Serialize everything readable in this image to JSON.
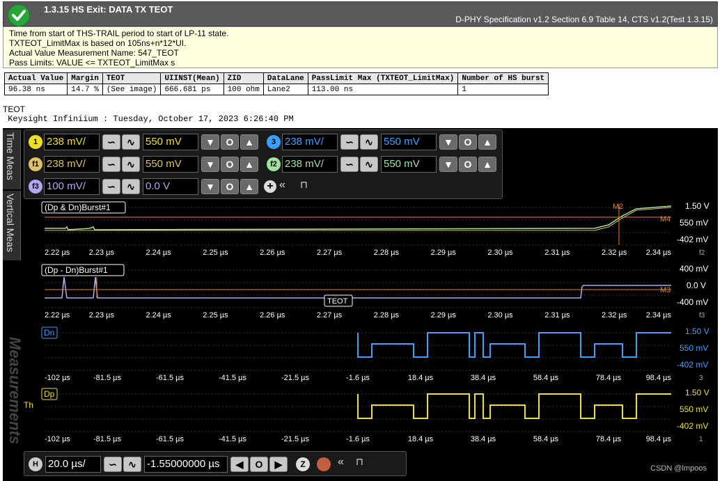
{
  "header": {
    "title": "1.3.15 HS Exit: DATA TX TEOT",
    "spec": "D-PHY Specification v1.2 Section 6.9 Table 14, CTS v1.2(Test 1.3.15)",
    "status_icon": "check-icon"
  },
  "description": {
    "line1": "Time from start of THS-TRAIL period to start of LP-11 state.",
    "line2": "TXTEOT_LimitMax is based on 105ns+n*12*UI.",
    "line3": "Actual Value Measurement Name: 547_TEOT",
    "line4": "Pass Limits: VALUE <= TXTEOT_LimitMax s"
  },
  "results": {
    "headers": [
      "Actual Value",
      "Margin",
      "TEOT",
      "UIINST(Mean)",
      "ZID",
      "DataLane",
      "PassLimit Max (TXTEOT_LimitMax)",
      "Number of HS burst"
    ],
    "values": [
      "96.38 ns",
      "14.7 %",
      "(See image)",
      "666.681 ps",
      "100 ohm",
      "Lane2",
      "113.00 ns",
      "1"
    ]
  },
  "caption": "TEOT",
  "scope_info": " Keysight Infiniium : Tuesday, October 17, 2023 6:26:40 PM",
  "tabs": {
    "time_meas": "Time Meas",
    "vertical_meas": "Vertical Meas",
    "measurements": "Measurements"
  },
  "channels": {
    "ch1": {
      "id": "1",
      "scale": "238 mV/",
      "offset": "550 mV",
      "color": "#f0e020"
    },
    "ch3": {
      "id": "3",
      "scale": "238 mV/",
      "offset": "550 mV",
      "color": "#3aa0ff"
    },
    "f1": {
      "id": "f1",
      "scale": "238 mV/",
      "offset": "550 mV",
      "color": "#e0c060"
    },
    "f2": {
      "id": "f2",
      "scale": "238 mV/",
      "offset": "550 mV",
      "color": "#a0e0a0"
    },
    "f3": {
      "id": "f3",
      "scale": "100 mV/",
      "offset": "0.0 V",
      "color": "#b0a8f0"
    }
  },
  "plots": [
    {
      "label": "(Dp & Dn)Burst#1",
      "ticks": [
        "2.22 µs",
        "2.23 µs",
        "2.24 µs",
        "2.25 µs",
        "2.26 µs",
        "2.27 µs",
        "2.28 µs",
        "2.29 µs",
        "2.30 µs",
        "2.31 µs",
        "2.32 µs",
        "2.34 µs"
      ],
      "right": [
        "1.50 V",
        "550 mV",
        "-402 mV"
      ],
      "markers": [
        "M2",
        "M4"
      ],
      "badge": "f2",
      "ch": "f1"
    },
    {
      "label": "(Dp - Dn)Burst#1",
      "ticks": [
        "2.22 µs",
        "2.23 µs",
        "2.24 µs",
        "2.25 µs",
        "2.26 µs",
        "2.27 µs",
        "2.28 µs",
        "2.29 µs",
        "2.30 µs",
        "2.31 µs",
        "2.32 µs",
        "2.34 µs"
      ],
      "right": [
        "400 mV",
        "0.0 V",
        "-400 mV"
      ],
      "markers": [
        "M3"
      ],
      "badge": "f3",
      "ch": "f3",
      "tag": "TEOT"
    },
    {
      "label": "Dn",
      "ticks": [
        "-102 µs",
        "-81.5 µs",
        "-61.5 µs",
        "-41.5 µs",
        "-21.5 µs",
        "-1.6 µs",
        "18.4 µs",
        "38.4 µs",
        "58.4 µs",
        "78.4 µs",
        "98.4 µs"
      ],
      "right": [
        "1.50 V",
        "550 mV",
        "-402 mV"
      ],
      "badge": "3",
      "ch": "3"
    },
    {
      "label": "Dp",
      "ticks": [
        "-102 µs",
        "-81.5 µs",
        "-61.5 µs",
        "-41.5 µs",
        "-21.5 µs",
        "-1.6 µs",
        "18.4 µs",
        "38.4 µs",
        "58.4 µs",
        "78.4 µs",
        "98.4 µs"
      ],
      "right": [
        "1.50 V",
        "550 mV",
        "-402 mV"
      ],
      "badge": "1",
      "ch": "Th",
      "th": "Th"
    }
  ],
  "timebase": {
    "h_label": "H",
    "scale": "20.0 µs/",
    "position": "-1.55000000 µs"
  },
  "watermark": "CSDN @lmpoos"
}
